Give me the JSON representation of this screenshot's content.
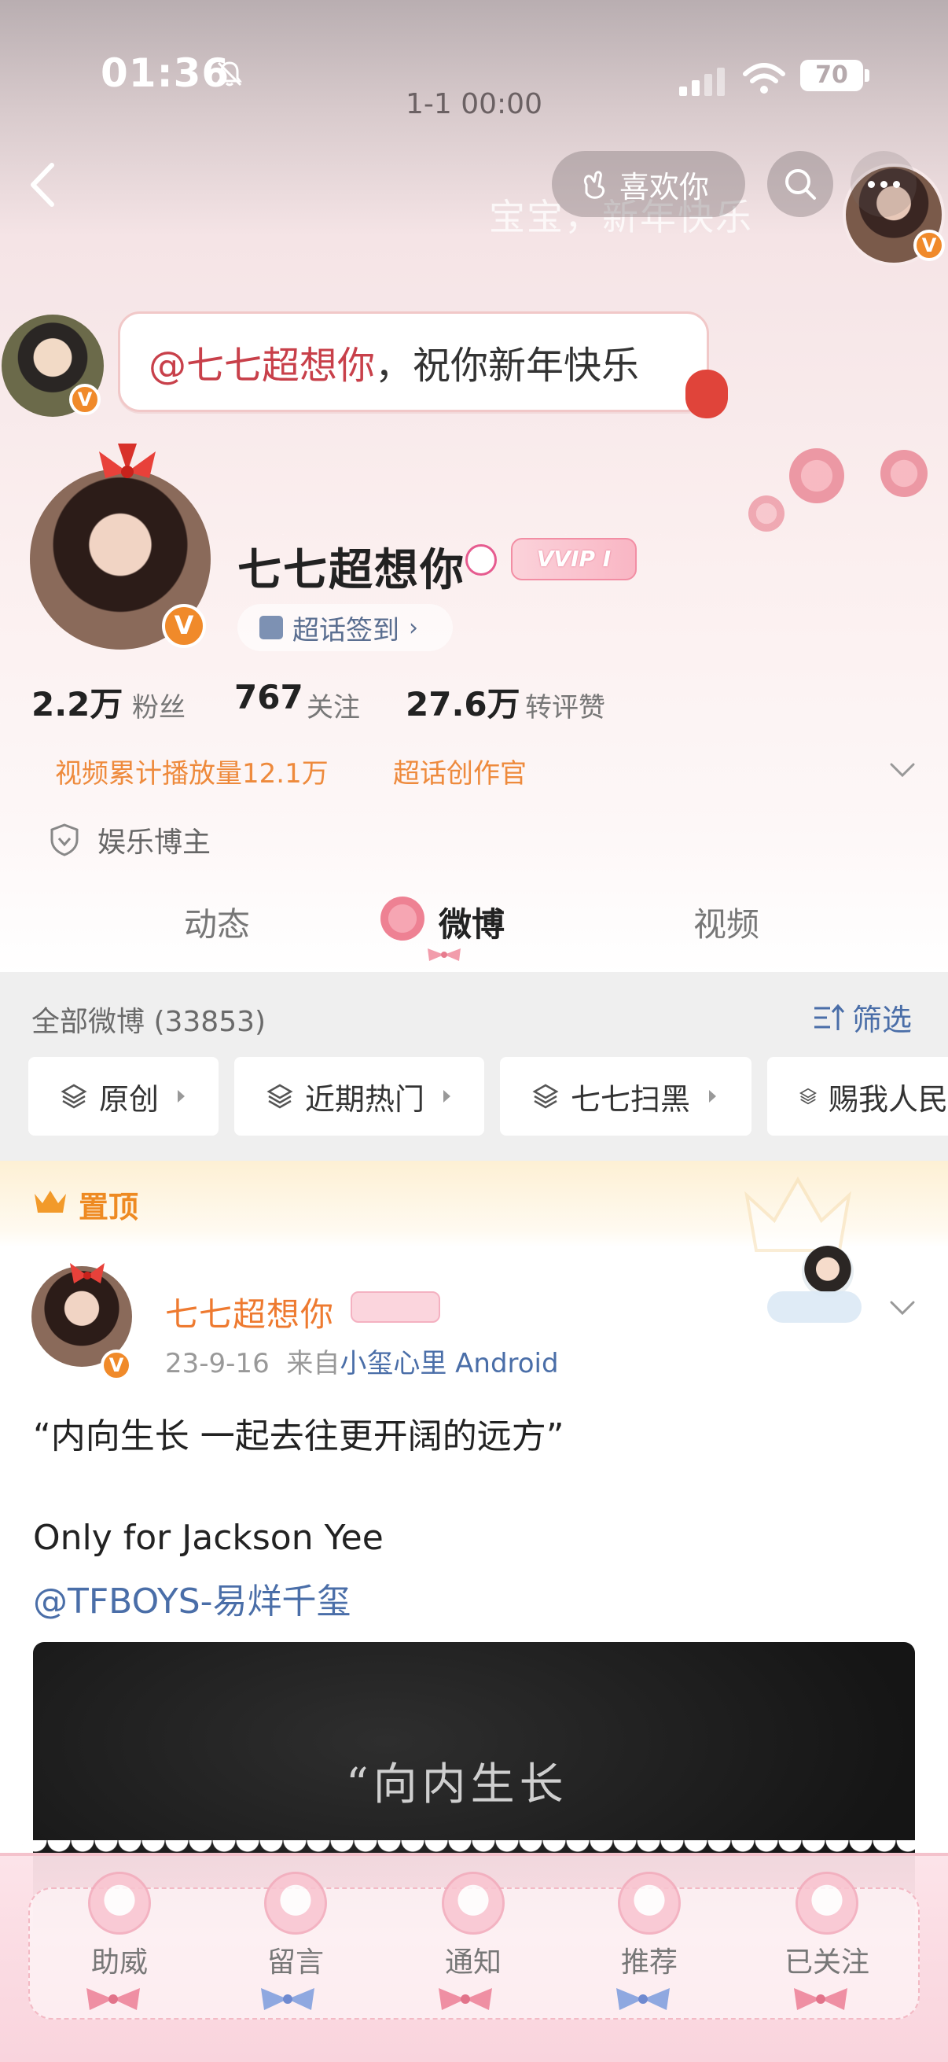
{
  "status_bar": {
    "time": "01:36",
    "date_line": "1-1 00:00",
    "battery": "70"
  },
  "top_nav": {
    "like_label": "喜欢你",
    "banner_greeting": "宝宝，新年快乐"
  },
  "greeting": {
    "mention": "@七七超想你",
    "message": "，祝你新年快乐"
  },
  "profile": {
    "name": "七七超想你",
    "vip_badge": "VVIP I",
    "verified_mark": "V",
    "chaohua_checkin": "超话签到",
    "stats": [
      {
        "value": "2.2万",
        "label": "粉丝"
      },
      {
        "value": "767",
        "label": "关注"
      },
      {
        "value": "27.6万",
        "label": "转评赞"
      }
    ],
    "highlights": [
      "视频累计播放量12.1万",
      "超话创作官"
    ],
    "category": "娱乐博主"
  },
  "tabs": [
    "动态",
    "微博",
    "视频"
  ],
  "active_tab": "微博",
  "filter": {
    "all_label": "全部微博 (33853)",
    "filter_label": "筛选",
    "chips": [
      "原创",
      "近期热门",
      "七七扫黑",
      "赐我人民"
    ]
  },
  "pinned": {
    "label": "置顶"
  },
  "post": {
    "author": "七七超想你",
    "date": "23-9-16",
    "source_prefix": "来自",
    "source": "小玺心里 Android",
    "line1": "“内向生长 一起去往更开阔的远方”",
    "line2": "Only for Jackson Yee",
    "mention": "@TFBOYS-易烊千玺",
    "image_text": "“向内生长"
  },
  "bottom_nav": [
    "助威",
    "留言",
    "通知",
    "推荐",
    "已关注"
  ],
  "colors": {
    "accent_orange": "#ee8a3c",
    "link_blue": "#4a6ea8",
    "pink": "#f4c2cc"
  }
}
